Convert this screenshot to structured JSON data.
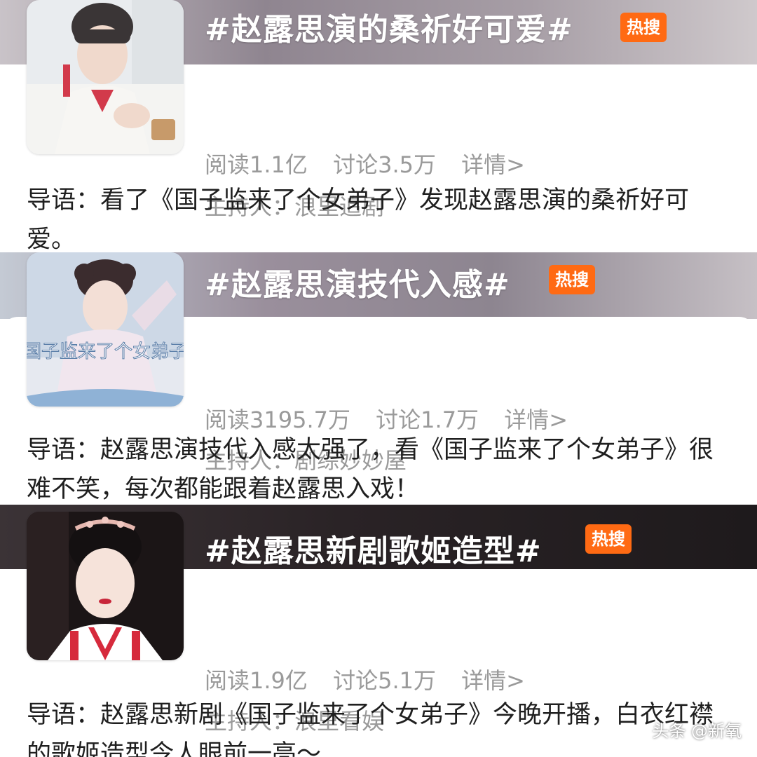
{
  "topics": [
    {
      "title": "#赵露思演的桑祈好可爱#",
      "badge": "热搜",
      "reads": "阅读1.1亿",
      "discussions": "讨论3.5万",
      "details": "详情>",
      "host": "主持人：浪里追剧",
      "intro": "导语：看了《国子监来了个女弟子》发现赵露思演的桑祈好可爱。"
    },
    {
      "title": "#赵露思演技代入感#",
      "badge": "热搜",
      "reads": "阅读3195.7万",
      "discussions": "讨论1.7万",
      "details": "详情>",
      "host": "主持人：剧综妙妙屋",
      "cover_text": "国子监来了个女弟子",
      "intro": "导语：赵露思演技代入感太强了，看《国子监来了个女弟子》很难不笑，每次都能跟着赵露思入戏！"
    },
    {
      "title": "#赵露思新剧歌姬造型#",
      "badge": "热搜",
      "reads": "阅读1.9亿",
      "discussions": "讨论5.1万",
      "details": "详情>",
      "host": "主持人：浪里看娱",
      "intro": "导语：赵露思新剧《国子监来了个女弟子》今晚开播，白衣红襟的歌姬造型令人眼前一亮～"
    }
  ],
  "watermark": "头条 @新氧",
  "colors": {
    "badge": "#ff6a13",
    "stats_text": "#9a9a9a",
    "body_text": "#1f1f1f"
  }
}
